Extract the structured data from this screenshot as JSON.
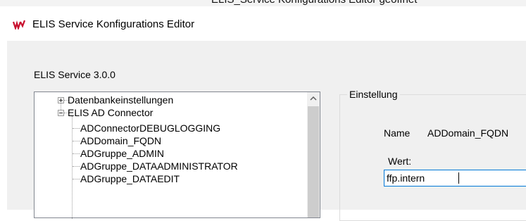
{
  "window": {
    "partial_top_text": "ELIS_Service Konfigurations Editor geöffnet",
    "title": "ELIS Service Konfigurations Editor"
  },
  "main": {
    "version_label": "ELIS Service 3.0.0",
    "tree": {
      "nodes": [
        {
          "label": "Datenbankeinstellungen",
          "level": 0,
          "expander": "plus"
        },
        {
          "label": "ELIS AD Connector",
          "level": 0,
          "expander": "minus"
        },
        {
          "label": "ADConnectorDEBUGLOGGING",
          "level": 1
        },
        {
          "label": "ADDomain_FQDN",
          "level": 1
        },
        {
          "label": "ADGruppe_ADMIN",
          "level": 1
        },
        {
          "label": "ADGruppe_DATAADMINISTRATOR",
          "level": 1
        },
        {
          "label": "ADGruppe_DATAEDIT",
          "level": 1
        }
      ]
    },
    "settings": {
      "caption": "Einstellung",
      "name_label": "Name",
      "name_value": "ADDomain_FQDN",
      "value_label": "Wert:",
      "value": "ffp.intern"
    }
  },
  "icons": {
    "app": "elis-app-icon",
    "scroll_up": "chevron-up-icon"
  },
  "colors": {
    "focus_border": "#0078d7",
    "panel_bg": "#f0f0f0"
  }
}
